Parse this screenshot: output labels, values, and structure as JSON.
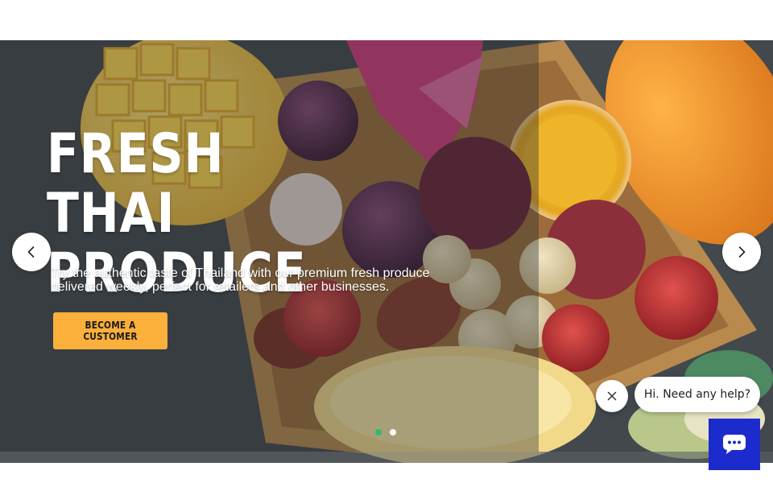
{
  "hero": {
    "title_lines": [
      "FRESH THAI",
      "PRODUCE"
    ],
    "description": "Try the authentic taste of Thailand with our premium fresh produce delivered weekly, perfect for retailers and other businesses.",
    "cta_label": "BECOME A CUSTOMER",
    "slide_count": 2,
    "active_slide": 1
  },
  "chat": {
    "greeting": "Hi. Need any help?",
    "launcher_icon": "chat-bubble-icon",
    "close_icon": "close-icon"
  },
  "icons": {
    "prev": "chevron-left-icon",
    "next": "chevron-right-icon"
  },
  "colors": {
    "cta_background": "#fbb03b",
    "launcher_background": "#1c2ccc",
    "dot_active": "#2eb872",
    "dot_inactive": "#ffffff"
  }
}
